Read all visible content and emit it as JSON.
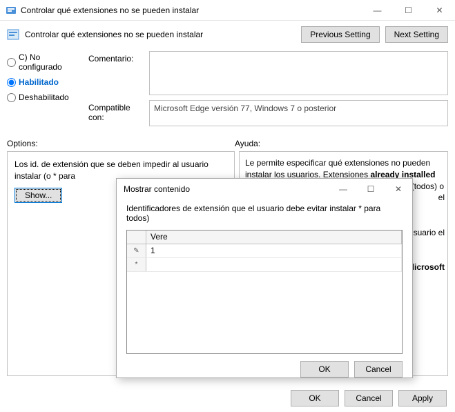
{
  "window": {
    "title": "Controlar qué extensiones no se pueden instalar",
    "minimize": "—",
    "maximize": "☐",
    "close": "✕"
  },
  "header": {
    "policy_title": "Controlar qué extensiones no se pueden instalar",
    "prev_btn": "Previous Setting",
    "next_btn": "Next Setting"
  },
  "radios": {
    "not_configured": "C) No configurado",
    "enabled": "Habilitado",
    "disabled": "Deshabilitado"
  },
  "labels": {
    "comment": "Comentario:",
    "compat": "Compatible con:",
    "options": "Options:",
    "help": "Ayuda:"
  },
  "fields": {
    "comment_value": "",
    "compat_value": "Microsoft Edge versión 77, Windows 7 o posterior"
  },
  "options": {
    "desc": "Los id. de extensión que se deben impedir al usuario instalar (o * para",
    "show_btn": "Show..."
  },
  "help": {
    "line1": "Le permite especificar qué extensiones no pueden instalar los usuarios. Extensiones",
    "line2_bold": "already installed will be disabled if blocked, without a way f",
    "line2_tail": "(todos) o",
    "line3_tail": "el",
    "line4_tail": "ess usuario el",
    "line5_bold": "licrosoft"
  },
  "modal": {
    "title": "Mostrar contenido",
    "desc": "Identificadores de extensión que el usuario debe evitar instalar * para todos)",
    "col_header": "Vere",
    "row1_value": "1",
    "row2_value": "",
    "ok": "OK",
    "cancel": "Cancel",
    "pencil": "✎",
    "star": "*"
  },
  "footer": {
    "ok": "OK",
    "cancel": "Cancel",
    "apply": "Apply"
  }
}
